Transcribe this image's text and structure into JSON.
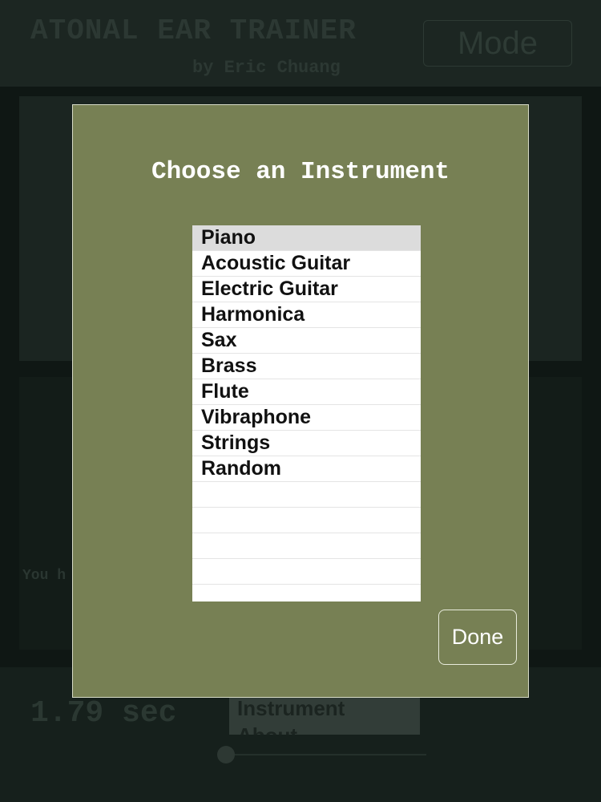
{
  "app": {
    "title": "ATONAL EAR TRAINER",
    "subtitle": "by Eric Chuang",
    "mode_label": "Mode",
    "hint_text": "You h",
    "timer": "1.79 sec",
    "menu_items": [
      "Instrument",
      "About"
    ]
  },
  "modal": {
    "title": "Choose an Instrument",
    "instruments": [
      "Piano",
      "Acoustic Guitar",
      "Electric Guitar",
      "Harmonica",
      "Sax",
      "Brass",
      "Flute",
      "Vibraphone",
      "Strings",
      "Random"
    ],
    "selected": "Piano",
    "done_label": "Done"
  },
  "colors": {
    "modal_background": "#778054",
    "selected_row": "#dcdcdc"
  }
}
